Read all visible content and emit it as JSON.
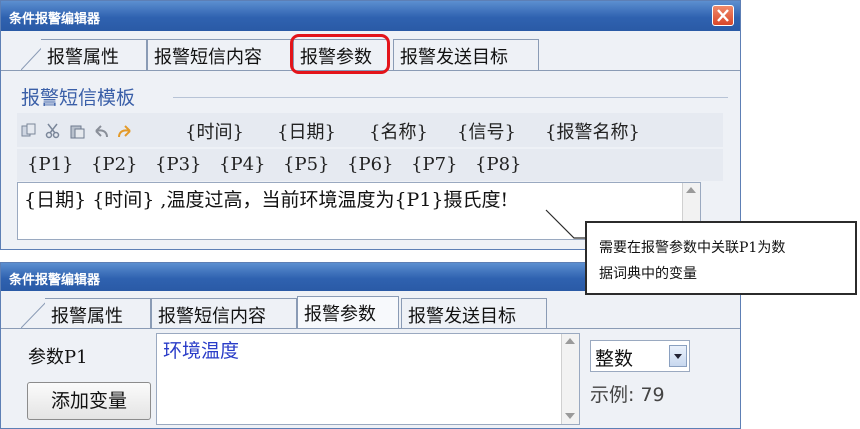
{
  "window1": {
    "title": "条件报警编辑器",
    "tabs": [
      "报警属性",
      "报警短信内容",
      "报警参数",
      "报警发送目标"
    ],
    "group_title": "报警短信模板",
    "toolbar_fields": [
      "{时间}",
      "{日期}",
      "{名称}",
      "{信号}",
      "{报警名称}"
    ],
    "param_fields": [
      "{P1}",
      "{P2}",
      "{P3}",
      "{P4}",
      "{P5}",
      "{P6}",
      "{P7}",
      "{P8}"
    ],
    "template_text": "{日期} {时间} ,温度过高，当前环境温度为{P1}摄氏度!"
  },
  "callout": {
    "line1": "需要在报警参数中关联P1为数",
    "line2": "据词典中的变量"
  },
  "window2": {
    "title": "条件报警编辑器",
    "tabs": [
      "报警属性",
      "报警短信内容",
      "报警参数",
      "报警发送目标"
    ],
    "param_label": "参数P1",
    "add_button": "添加变量",
    "variable_text": "环境温度",
    "type_select": "整数",
    "example": "示例: 79"
  },
  "colors": {
    "titlebar": "#2f62b0",
    "highlight": "#e3141a",
    "variable_text": "#2a3cc8",
    "group_title": "#3a5fa8"
  }
}
